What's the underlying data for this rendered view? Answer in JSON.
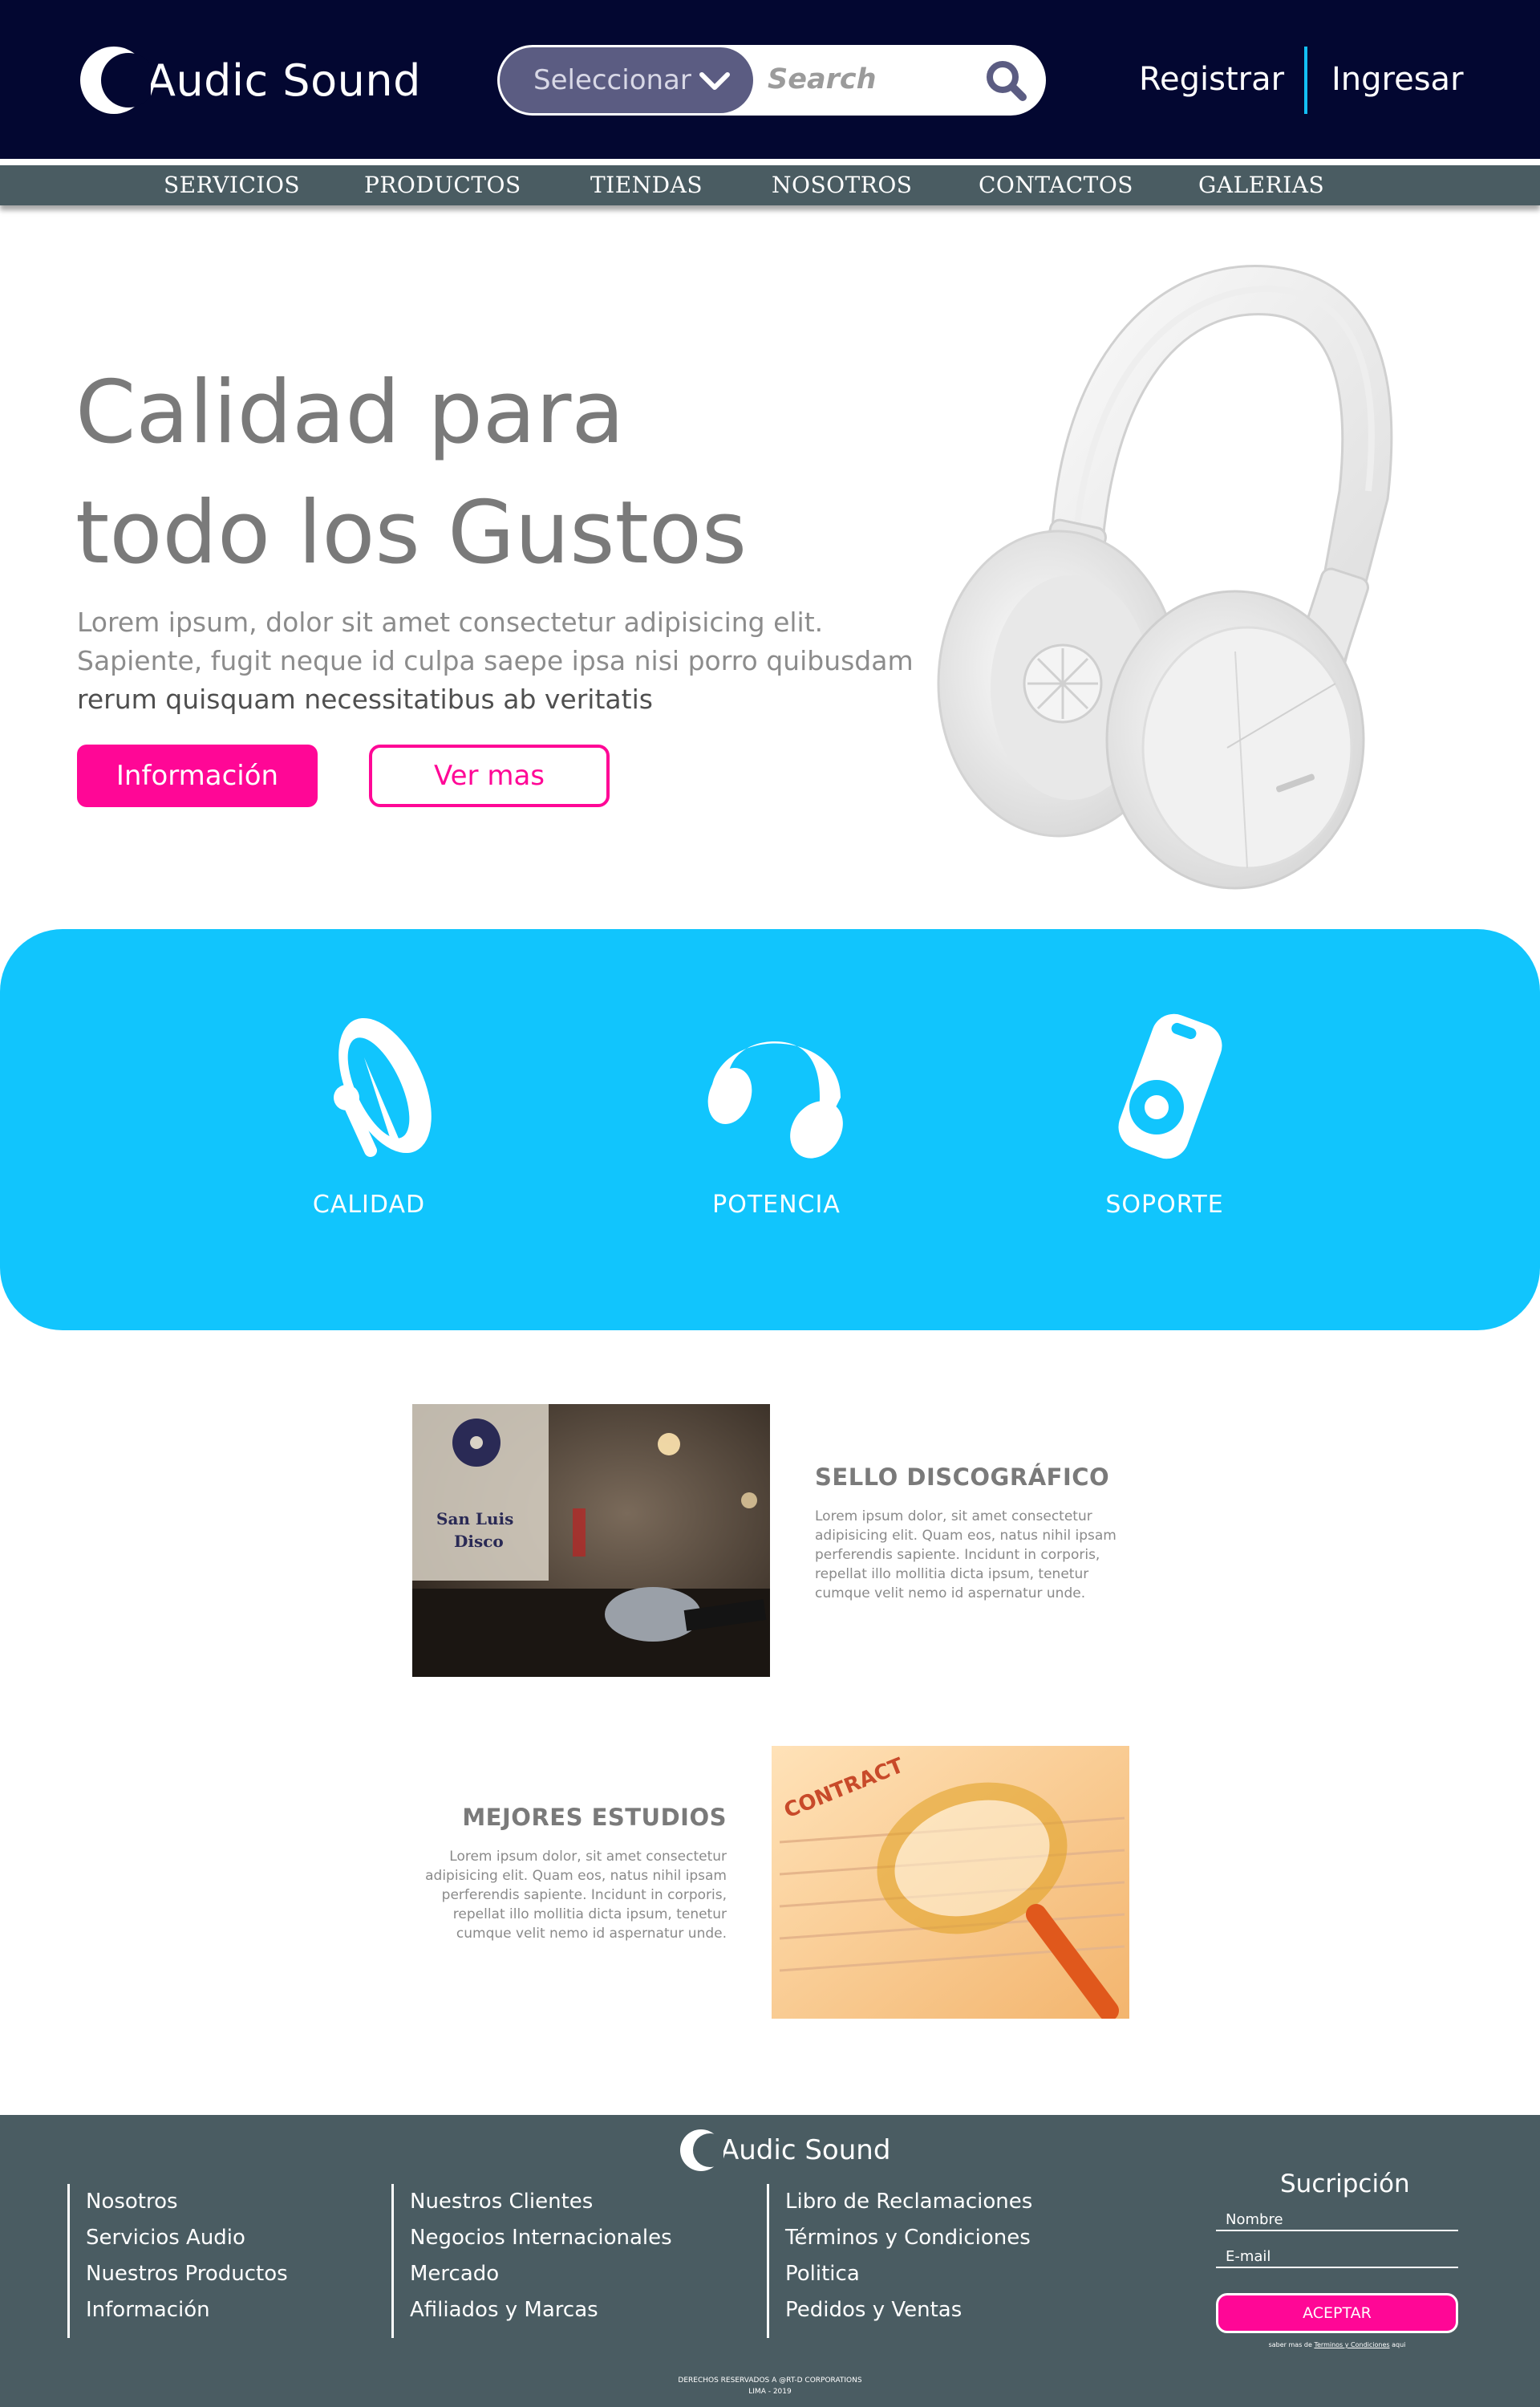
{
  "brand": {
    "name": "Audic Sound"
  },
  "header": {
    "select_label": "Seleccionar",
    "search_placeholder": "Search",
    "register": "Registrar",
    "login": "Ingresar"
  },
  "nav": [
    "SERVICIOS",
    "PRODUCTOS",
    "TIENDAS",
    "NOSOTROS",
    "CONTACTOS",
    "GALERIAS"
  ],
  "hero": {
    "title_line1": "Calidad para",
    "title_line2": "todo los Gustos",
    "text_line1": "Lorem ipsum, dolor sit amet consectetur adipisicing elit.",
    "text_line2": "Sapiente, fugit neque id culpa saepe ipsa nisi porro quibusdam",
    "text_line3": "rerum quisquam necessitatibus ab veritatis",
    "btn_info": "Información",
    "btn_more": "Ver mas"
  },
  "features": [
    {
      "label": "CALIDAD",
      "icon": "satellite-dish-icon"
    },
    {
      "label": "POTENCIA",
      "icon": "headphones-icon"
    },
    {
      "label": "SOPORTE",
      "icon": "music-player-icon"
    }
  ],
  "sections": [
    {
      "title": "SELLO DISCOGRÁFICO",
      "text": "Lorem ipsum dolor, sit amet consectetur adipisicing elit. Quam eos, natus nihil ipsam perferendis sapiente. Incidunt in corporis, repellat illo mollitia dicta ipsum, tenetur cumque velit nemo id aspernatur unde.",
      "photo_sign_line1": "San Luis",
      "photo_sign_line2": "Disco"
    },
    {
      "title": "MEJORES ESTUDIOS",
      "text": "Lorem ipsum dolor, sit amet consectetur adipisicing elit. Quam eos, natus nihil ipsam perferendis sapiente. Incidunt in corporis, repellat illo mollitia dicta ipsum, tenetur cumque velit nemo id aspernatur unde.",
      "photo_word": "CONTRACT"
    }
  ],
  "footer": {
    "col1": [
      "Nosotros",
      "Servicios Audio",
      "Nuestros Productos",
      "Información"
    ],
    "col2": [
      "Nuestros Clientes",
      "Negocios Internacionales",
      "Mercado",
      "Afiliados y Marcas"
    ],
    "col3": [
      "Libro de Reclamaciones",
      "Términos y Condiciones",
      "Politica",
      "Pedidos y Ventas"
    ],
    "subscription": {
      "title": "Sucripción",
      "name_field": "Nombre",
      "email_field": "E-mail",
      "button": "ACEPTAR",
      "note_before": "saber mas de",
      "note_link": "Terminos y Condiciones",
      "note_after": "aqui"
    },
    "copyright": "DERECHOS RESERVADOS A @RT-D CORPORATIONS",
    "location_year": "LIMA - 2019"
  },
  "colors": {
    "header_bg": "#030731",
    "nav_bg": "#4a5c62",
    "accent_pink": "#ff0796",
    "accent_cyan": "#11c5fd"
  }
}
